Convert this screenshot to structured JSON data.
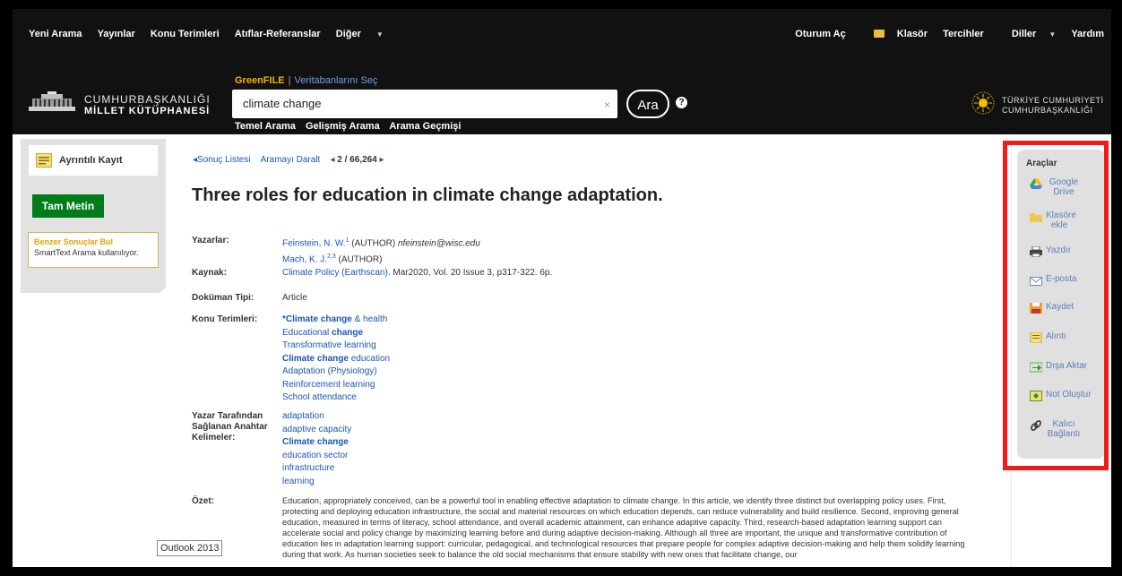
{
  "nav": {
    "left": [
      "Yeni Arama",
      "Yayınlar",
      "Konu Terimleri",
      "Atıflar-Referanslar",
      "Diğer"
    ],
    "right": [
      "Oturum Aç",
      "Klasör",
      "Tercihler",
      "Diller",
      "Yardım"
    ]
  },
  "logo": {
    "line1": "CUMHURBAŞKANLIĞI",
    "line2": "MİLLET KÜTÜPHANESİ"
  },
  "database": {
    "name": "GreenFILE",
    "choose": "Veritabanlarını Seç"
  },
  "search": {
    "value": "climate change",
    "button": "Ara",
    "help": "?",
    "clear": "×",
    "links": [
      "Temel Arama",
      "Gelişmiş Arama",
      "Arama Geçmişi"
    ]
  },
  "tc_logo": {
    "line1": "TÜRKİYE CUMHURİYETİ",
    "line2": "CUMHURBAŞKANLIĞI"
  },
  "left_panel": {
    "record": "Ayrıntılı Kayıt",
    "full_text": "Tam Metin",
    "similar_title": "Benzer Sonuçlar Bul",
    "similar_sub": "SmartText Arama kullanılıyor."
  },
  "breadcrumb": {
    "result_list": "Sonuç Listesi",
    "narrow": "Aramayı Daralt",
    "position": "2 / 66,264"
  },
  "record": {
    "title": "Three roles for education in climate change adaptation.",
    "authors_label": "Yazarlar:",
    "authors": [
      {
        "name": "Feinstein, N. W.",
        "sup": "1",
        "role": " (AUTHOR) ",
        "email": "nfeinstein@wisc.edu"
      },
      {
        "name": "Mach, K. J.",
        "sup": "2,3",
        "role": " (AUTHOR)",
        "email": ""
      }
    ],
    "source_label": "Kaynak:",
    "source_link": "Climate Policy (Earthscan)",
    "source_rest": ". Mar2020, Vol. 20 Issue 3, p317-322. 6p.",
    "doctype_label": "Doküman Tipi:",
    "doctype": "Article",
    "subjects_label": "Konu Terimleri:",
    "subjects": [
      "*Climate change & health",
      "Educational change",
      "Transformative learning",
      "Climate change education",
      "Adaptation (Physiology)",
      "Reinforcement learning",
      "School attendance"
    ],
    "keywords_label": "Yazar Tarafından Sağlanan Anahtar Kelimeler:",
    "keywords": [
      "adaptation",
      "adaptive capacity",
      "Climate change",
      "education sector",
      "infrastructure",
      "learning"
    ],
    "abstract_label": "Özet:",
    "abstract": "Education, appropriately conceived, can be a powerful tool in enabling effective adaptation to climate change. In this article, we identify three distinct but overlapping policy uses. First, protecting and deploying education infrastructure, the social and material resources on which education depends, can reduce vulnerability and build resilience. Second, improving general education, measured in terms of literacy, school attendance, and overall academic attainment, can enhance adaptive capacity. Third, research-based adaptation learning support can accelerate social and policy change by maximizing learning before and during adaptive decision-making. Although all three are important, the unique and transformative contribution of education lies in adaptation learning support: curricular, pedagogical, and technological resources that prepare people for complex adaptive decision-making and help them solidify learning during that work. As human societies seek to balance the old social mechanisms that ensure stability with new ones that facilitate change, our"
  },
  "tools": {
    "title": "Araçlar",
    "items": [
      "Google Drive",
      "Klasöre ekle",
      "Yazdır",
      "E-posta",
      "Kaydet",
      "Alıntı",
      "Dışa Aktar",
      "Not Oluştur",
      "Kalıcı Bağlantı"
    ],
    "colors": {
      "accent": "#5a7fb8",
      "highlight_box": "#f21b1b"
    }
  },
  "tooltip": "Outlook 2013"
}
